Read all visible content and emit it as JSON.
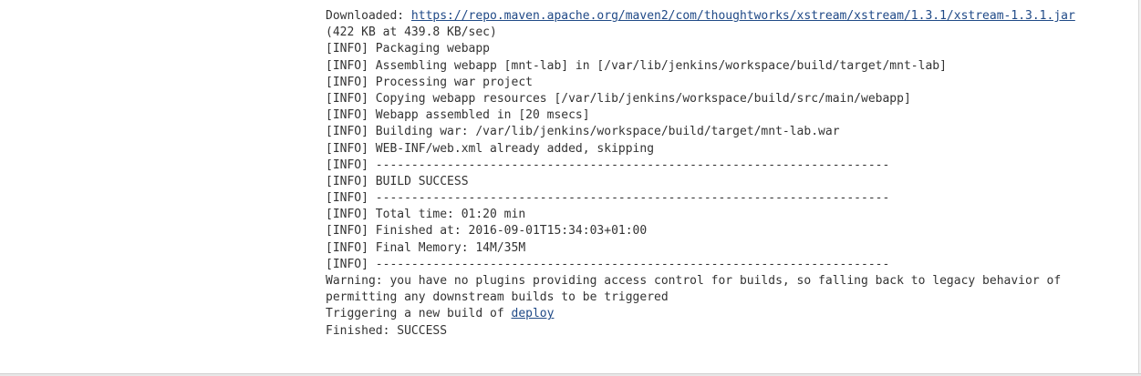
{
  "console": {
    "downloaded_prefix": "Downloaded: ",
    "downloaded_url": "https://repo.maven.apache.org/maven2/com/thoughtworks/xstream/xstream/1.3.1/xstream-1.3.1.jar",
    "download_rate": "(422 KB at 439.8 KB/sec)",
    "lines": [
      "[INFO] Packaging webapp",
      "[INFO] Assembling webapp [mnt-lab] in [/var/lib/jenkins/workspace/build/target/mnt-lab]",
      "[INFO] Processing war project",
      "[INFO] Copying webapp resources [/var/lib/jenkins/workspace/build/src/main/webapp]",
      "[INFO] Webapp assembled in [20 msecs]",
      "[INFO] Building war: /var/lib/jenkins/workspace/build/target/mnt-lab.war",
      "[INFO] WEB-INF/web.xml already added, skipping",
      "[INFO] ------------------------------------------------------------------------",
      "[INFO] BUILD SUCCESS",
      "[INFO] ------------------------------------------------------------------------",
      "[INFO] Total time: 01:20 min",
      "[INFO] Finished at: 2016-09-01T15:34:03+01:00",
      "[INFO] Final Memory: 14M/35M",
      "[INFO] ------------------------------------------------------------------------",
      "Warning: you have no plugins providing access control for builds, so falling back to legacy behavior of",
      "permitting any downstream builds to be triggered"
    ],
    "trigger_prefix": "Triggering a new build of ",
    "trigger_link": "deploy",
    "finished": "Finished: SUCCESS"
  }
}
